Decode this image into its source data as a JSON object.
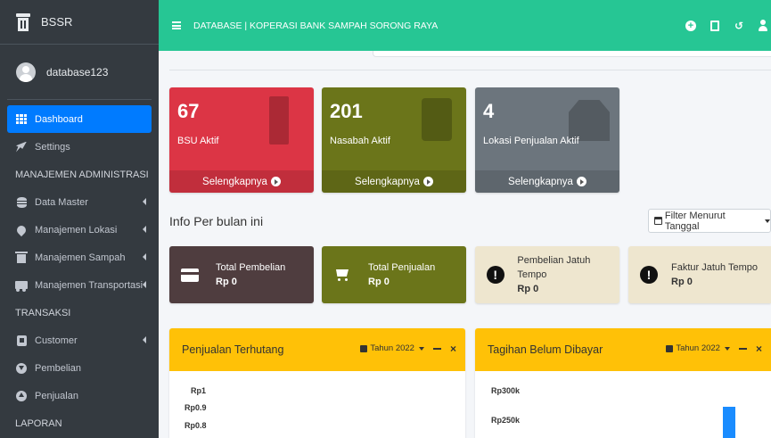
{
  "brand": {
    "name": "BSSR"
  },
  "user": {
    "name": "database123"
  },
  "sidebar": {
    "items": [
      {
        "label": "Dashboard",
        "active": true
      },
      {
        "label": "Settings"
      }
    ],
    "header_admin": "MANAJEMEN ADMINISTRASI",
    "admin_items": [
      {
        "label": "Data Master"
      },
      {
        "label": "Manajemen Lokasi"
      },
      {
        "label": "Manajemen Sampah"
      },
      {
        "label": "Manajemen Transportasi"
      }
    ],
    "header_transaksi": "TRANSAKSI",
    "transaksi_items": [
      {
        "label": "Customer"
      },
      {
        "label": "Pembelian"
      },
      {
        "label": "Penjualan"
      }
    ],
    "header_laporan": "LAPORAN"
  },
  "topbar": {
    "title": "DATABASE | KOPERASI BANK SAMPAH SORONG RAYA"
  },
  "stat_boxes": [
    {
      "value": "67",
      "label": "BSU Aktif",
      "link": "Selengkapnya",
      "color": "#dc3545"
    },
    {
      "value": "201",
      "label": "Nasabah Aktif",
      "link": "Selengkapnya",
      "color": "#6b751a"
    },
    {
      "value": "4",
      "label": "Lokasi Penjualan Aktif",
      "link": "Selengkapnya",
      "color": "#6c757d"
    }
  ],
  "monthly": {
    "title": "Info Per bulan ini",
    "filter_label": "Filter Menurut Tanggal"
  },
  "info_boxes": [
    {
      "label": "Total Pembelian",
      "value": "Rp 0"
    },
    {
      "label": "Total Penjualan",
      "value": "Rp 0"
    },
    {
      "label": "Pembelian Jatuh Tempo",
      "value": "Rp 0"
    },
    {
      "label": "Faktur Jatuh Tempo",
      "value": "Rp 0"
    }
  ],
  "cards": [
    {
      "title": "Penjualan Terhutang",
      "year": "Tahun 2022",
      "ticks": [
        "Rp1",
        "Rp0.9",
        "Rp0.8"
      ]
    },
    {
      "title": "Tagihan Belum Dibayar",
      "year": "Tahun 2022",
      "ticks": [
        "Rp300k",
        "Rp250k"
      ]
    }
  ],
  "colors": {
    "topbar": "#26c694",
    "sidebar": "#343a40",
    "accent": "#007bff",
    "card_header": "#ffc107"
  }
}
